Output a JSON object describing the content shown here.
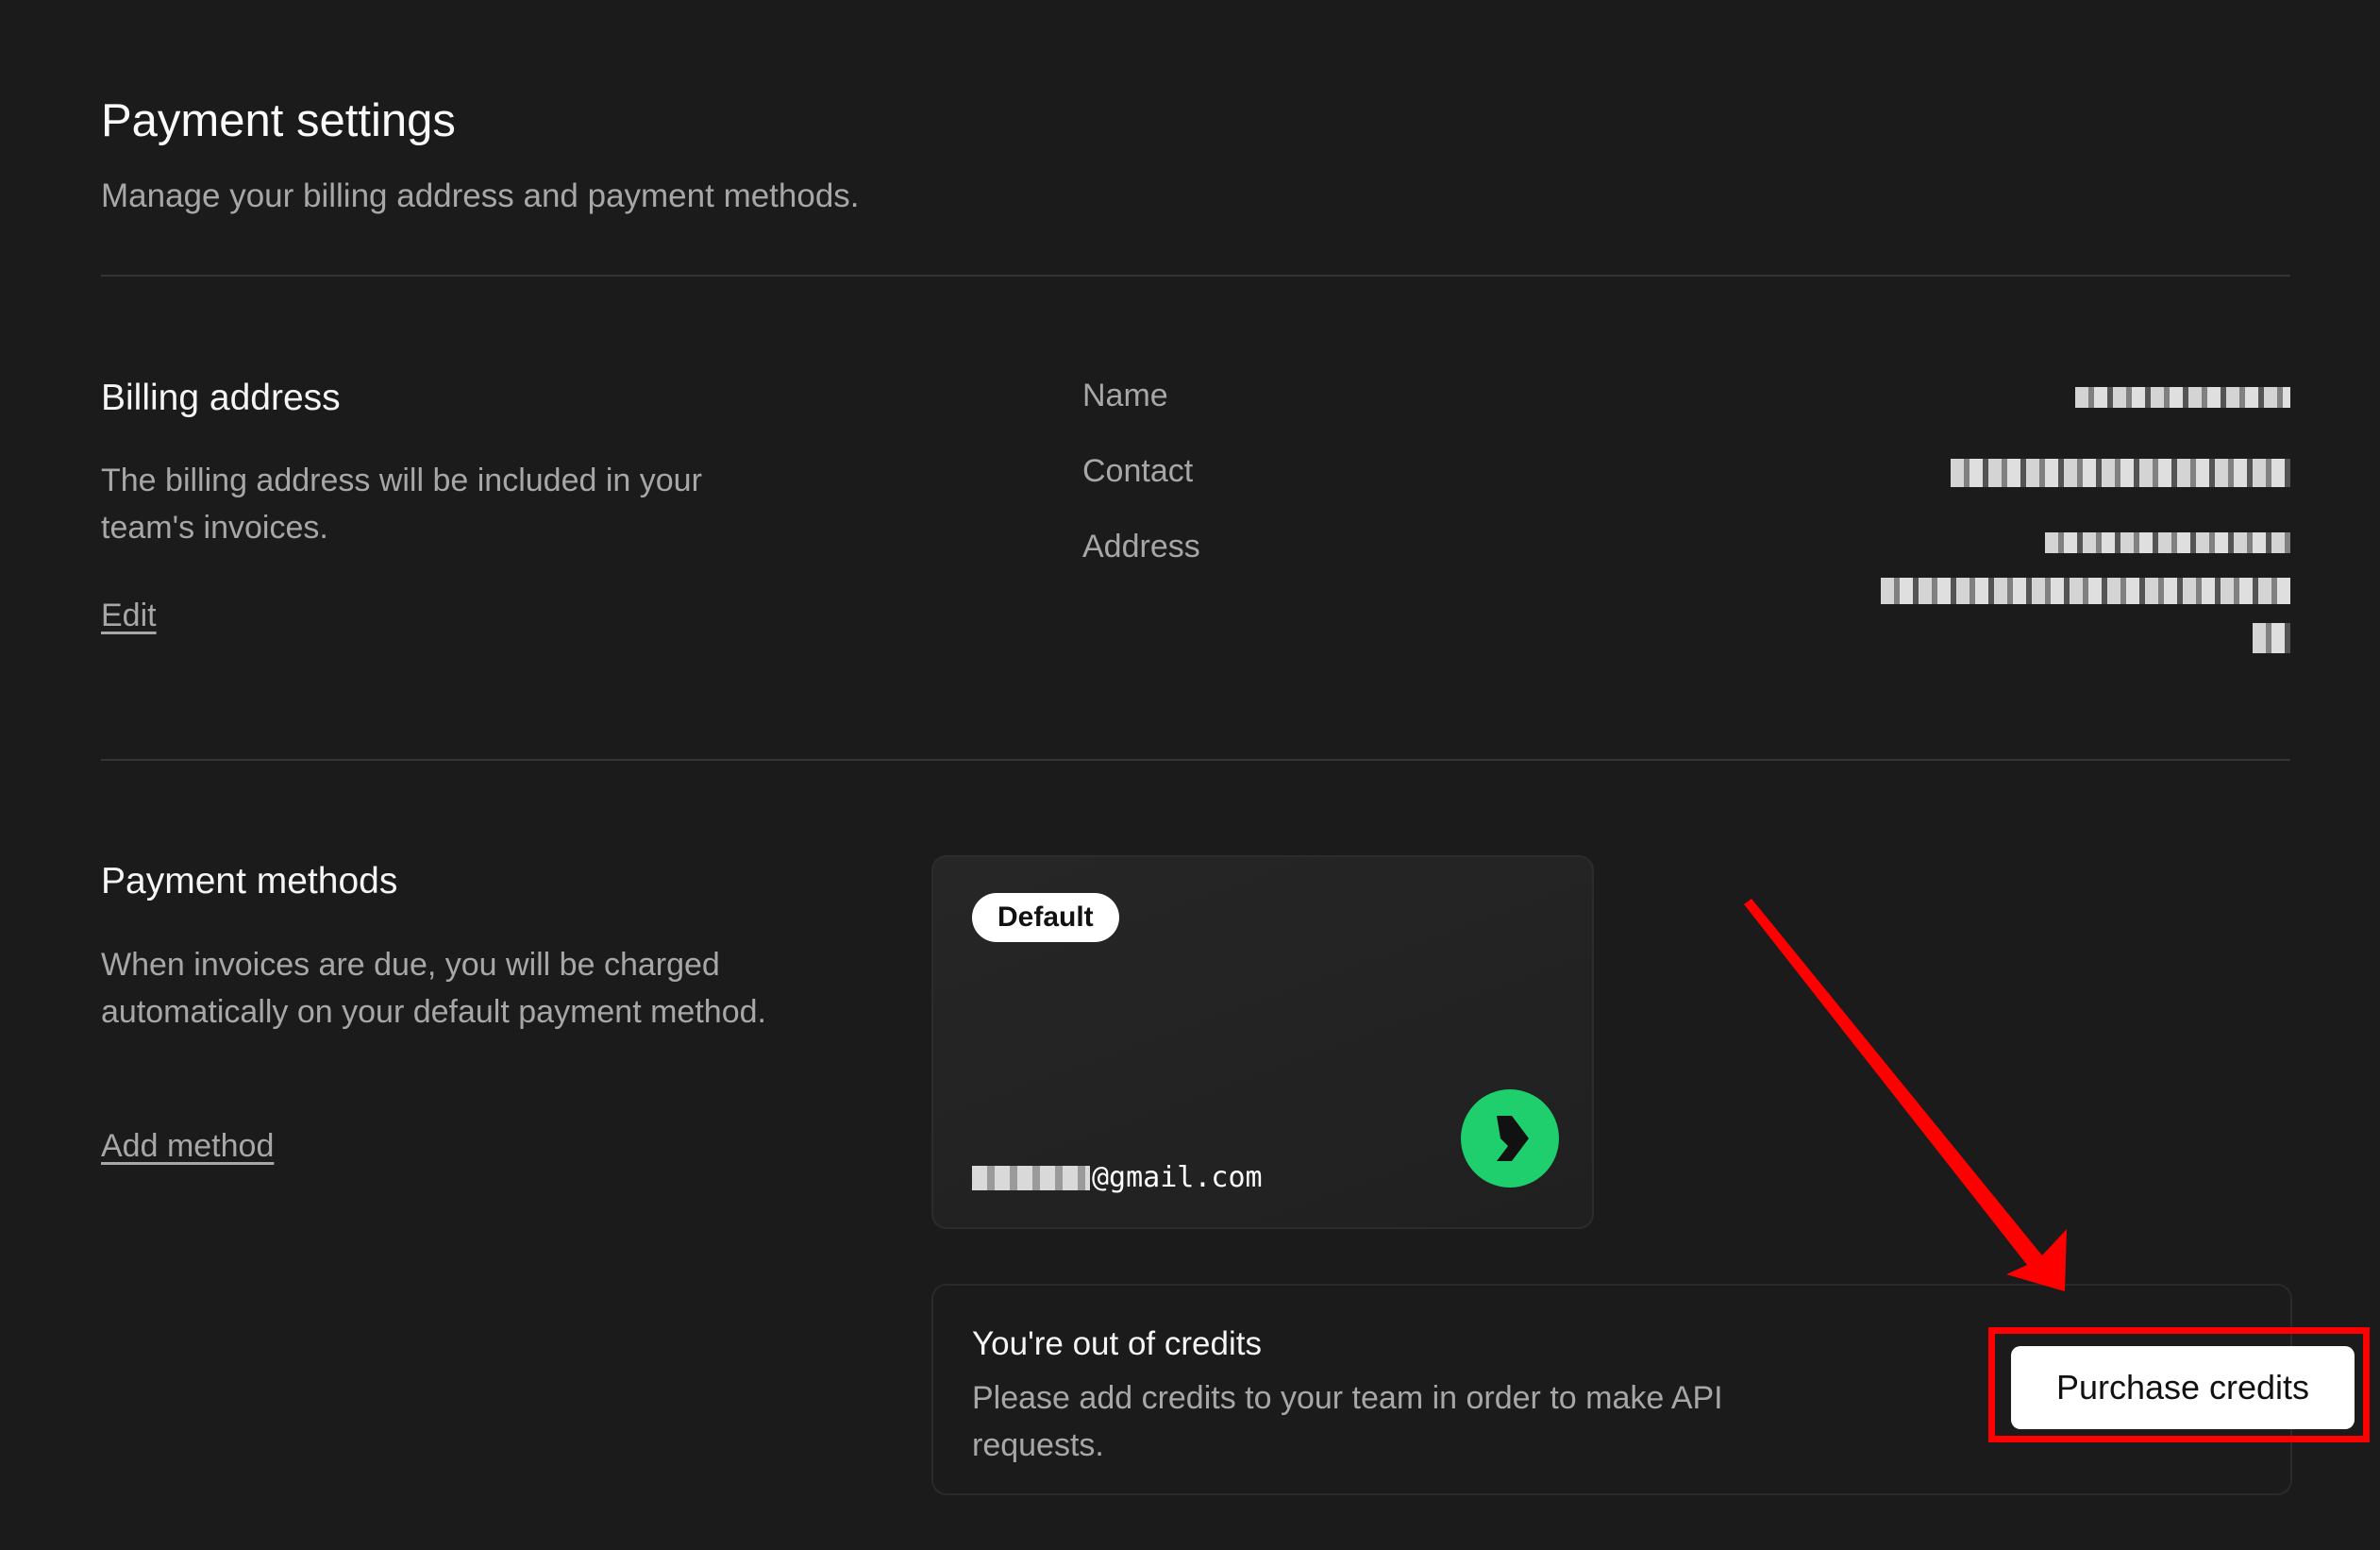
{
  "header": {
    "title": "Payment settings",
    "subtitle": "Manage your billing address and payment methods."
  },
  "billing": {
    "title": "Billing address",
    "description": "The billing address will be included in your team's invoices.",
    "edit_label": "Edit",
    "fields": {
      "name_label": "Name",
      "contact_label": "Contact",
      "address_label": "Address"
    }
  },
  "payment_methods": {
    "title": "Payment methods",
    "description": "When invoices are due, you will be charged automatically on your default payment method.",
    "add_label": "Add method",
    "card": {
      "badge": "Default",
      "email_visible": "@gmail.com",
      "brand_icon": "link-icon",
      "brand_color": "#1fcf6e"
    }
  },
  "credits": {
    "title": "You're out of credits",
    "description": "Please add credits to your team in order to make API requests.",
    "button_label": "Purchase credits"
  },
  "annotation": {
    "color": "#ff0000",
    "type": "red-arrow-and-box"
  }
}
